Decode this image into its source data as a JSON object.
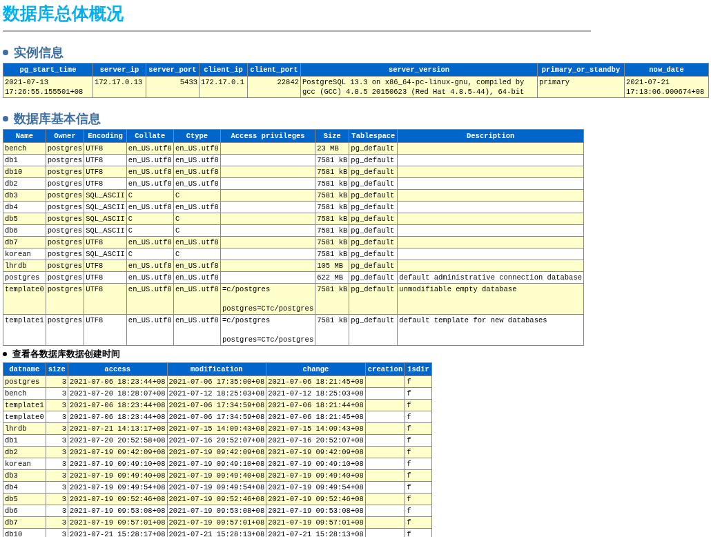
{
  "title": "数据库总体概况",
  "sections": [
    {
      "heading": "实例信息",
      "kind": "major",
      "table": {
        "columns": [
          {
            "label": "pg_start_time",
            "kind": "text"
          },
          {
            "label": "server_ip",
            "kind": "text"
          },
          {
            "label": "server_port",
            "kind": "number"
          },
          {
            "label": "client_ip",
            "kind": "text"
          },
          {
            "label": "client_port",
            "kind": "number"
          },
          {
            "label": "server_version",
            "kind": "text"
          },
          {
            "label": "primary_or_standby",
            "kind": "text"
          },
          {
            "label": "now_date",
            "kind": "text"
          }
        ],
        "rows": [
          [
            "2021-07-13 17:26:55.155501+08",
            "172.17.0.13",
            "5433",
            "172.17.0.1",
            "22842",
            "PostgreSQL 13.3 on x86_64-pc-linux-gnu, compiled by gcc (GCC) 4.8.5 20150623 (Red Hat 4.8.5-44), 64-bit",
            "primary",
            "2021-07-21 17:13:06.900674+08"
          ]
        ]
      }
    },
    {
      "heading": "数据库基本信息",
      "kind": "major",
      "table": {
        "columns": [
          {
            "label": "Name",
            "kind": "text"
          },
          {
            "label": "Owner",
            "kind": "text"
          },
          {
            "label": "Encoding",
            "kind": "text"
          },
          {
            "label": "Collate",
            "kind": "text"
          },
          {
            "label": "Ctype",
            "kind": "text"
          },
          {
            "label": "Access privileges",
            "kind": "text"
          },
          {
            "label": "Size",
            "kind": "text"
          },
          {
            "label": "Tablespace",
            "kind": "text"
          },
          {
            "label": "Description",
            "kind": "text"
          }
        ],
        "rows": [
          [
            "bench",
            "postgres",
            "UTF8",
            "en_US.utf8",
            "en_US.utf8",
            "",
            "23 MB",
            "pg_default",
            ""
          ],
          [
            "db1",
            "postgres",
            "UTF8",
            "en_US.utf8",
            "en_US.utf8",
            "",
            "7581 kB",
            "pg_default",
            ""
          ],
          [
            "db10",
            "postgres",
            "UTF8",
            "en_US.utf8",
            "en_US.utf8",
            "",
            "7581 kB",
            "pg_default",
            ""
          ],
          [
            "db2",
            "postgres",
            "UTF8",
            "en_US.utf8",
            "en_US.utf8",
            "",
            "7581 kB",
            "pg_default",
            ""
          ],
          [
            "db3",
            "postgres",
            "SQL_ASCII",
            "C",
            "C",
            "",
            "7581 kB",
            "pg_default",
            ""
          ],
          [
            "db4",
            "postgres",
            "SQL_ASCII",
            "en_US.utf8",
            "en_US.utf8",
            "",
            "7581 kB",
            "pg_default",
            ""
          ],
          [
            "db5",
            "postgres",
            "SQL_ASCII",
            "C",
            "C",
            "",
            "7581 kB",
            "pg_default",
            ""
          ],
          [
            "db6",
            "postgres",
            "SQL_ASCII",
            "C",
            "C",
            "",
            "7581 kB",
            "pg_default",
            ""
          ],
          [
            "db7",
            "postgres",
            "UTF8",
            "en_US.utf8",
            "en_US.utf8",
            "",
            "7581 kB",
            "pg_default",
            ""
          ],
          [
            "korean",
            "postgres",
            "SQL_ASCII",
            "C",
            "C",
            "",
            "7581 kB",
            "pg_default",
            ""
          ],
          [
            "lhrdb",
            "postgres",
            "UTF8",
            "en_US.utf8",
            "en_US.utf8",
            "",
            "105 MB",
            "pg_default",
            ""
          ],
          [
            "postgres",
            "postgres",
            "UTF8",
            "en_US.utf8",
            "en_US.utf8",
            "",
            "622 MB",
            "pg_default",
            "default administrative connection database"
          ],
          [
            "template0",
            "postgres",
            "UTF8",
            "en_US.utf8",
            "en_US.utf8",
            "=c/postgres\n\npostgres=CTc/postgres",
            "7581 kB",
            "pg_default",
            "unmodifiable empty database"
          ],
          [
            "template1",
            "postgres",
            "UTF8",
            "en_US.utf8",
            "en_US.utf8",
            "=c/postgres\n\npostgres=CTc/postgres",
            "7581 kB",
            "pg_default",
            "default template for new databases"
          ]
        ]
      }
    },
    {
      "heading": "查看各数据库数据创建时间",
      "kind": "minor",
      "table": {
        "columns": [
          {
            "label": "datname",
            "kind": "text"
          },
          {
            "label": "size",
            "kind": "number"
          },
          {
            "label": "access",
            "kind": "text"
          },
          {
            "label": "modification",
            "kind": "text"
          },
          {
            "label": "change",
            "kind": "text"
          },
          {
            "label": "creation",
            "kind": "text"
          },
          {
            "label": "isdir",
            "kind": "text"
          }
        ],
        "rows": [
          [
            "postgres",
            "3",
            "2021-07-06 18:23:44+08",
            "2021-07-06 17:35:00+08",
            "2021-07-06 18:21:45+08",
            "",
            "f"
          ],
          [
            "bench",
            "3",
            "2021-07-20 18:28:07+08",
            "2021-07-12 18:25:03+08",
            "2021-07-12 18:25:03+08",
            "",
            "f"
          ],
          [
            "template1",
            "3",
            "2021-07-06 18:23:44+08",
            "2021-07-06 17:34:59+08",
            "2021-07-06 18:21:44+08",
            "",
            "f"
          ],
          [
            "template0",
            "3",
            "2021-07-06 18:23:44+08",
            "2021-07-06 17:34:59+08",
            "2021-07-06 18:21:45+08",
            "",
            "f"
          ],
          [
            "lhrdb",
            "3",
            "2021-07-21 14:13:17+08",
            "2021-07-15 14:09:43+08",
            "2021-07-15 14:09:43+08",
            "",
            "f"
          ],
          [
            "db1",
            "3",
            "2021-07-20 20:52:58+08",
            "2021-07-16 20:52:07+08",
            "2021-07-16 20:52:07+08",
            "",
            "f"
          ],
          [
            "db2",
            "3",
            "2021-07-19 09:42:09+08",
            "2021-07-19 09:42:09+08",
            "2021-07-19 09:42:09+08",
            "",
            "f"
          ],
          [
            "korean",
            "3",
            "2021-07-19 09:49:10+08",
            "2021-07-19 09:49:10+08",
            "2021-07-19 09:49:10+08",
            "",
            "f"
          ],
          [
            "db3",
            "3",
            "2021-07-19 09:49:40+08",
            "2021-07-19 09:49:40+08",
            "2021-07-19 09:49:40+08",
            "",
            "f"
          ],
          [
            "db4",
            "3",
            "2021-07-19 09:49:54+08",
            "2021-07-19 09:49:54+08",
            "2021-07-19 09:49:54+08",
            "",
            "f"
          ],
          [
            "db5",
            "3",
            "2021-07-19 09:52:46+08",
            "2021-07-19 09:52:46+08",
            "2021-07-19 09:52:46+08",
            "",
            "f"
          ],
          [
            "db6",
            "3",
            "2021-07-19 09:53:08+08",
            "2021-07-19 09:53:08+08",
            "2021-07-19 09:53:08+08",
            "",
            "f"
          ],
          [
            "db7",
            "3",
            "2021-07-19 09:57:01+08",
            "2021-07-19 09:57:01+08",
            "2021-07-19 09:57:01+08",
            "",
            "f"
          ],
          [
            "db10",
            "3",
            "2021-07-21 15:28:17+08",
            "2021-07-21 15:28:13+08",
            "2021-07-21 15:28:13+08",
            "",
            "f"
          ]
        ]
      }
    }
  ]
}
